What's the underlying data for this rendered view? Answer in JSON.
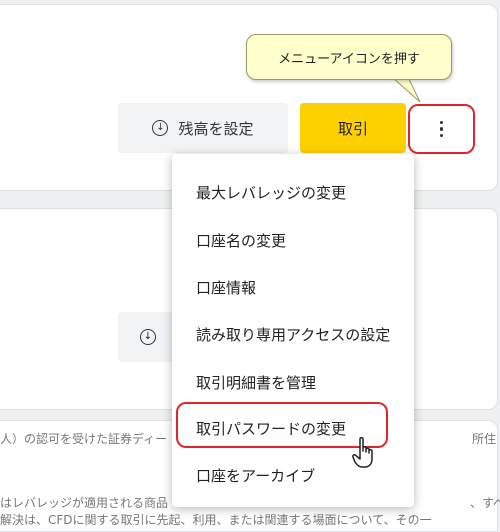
{
  "tooltip": {
    "text": "メニューアイコンを押す"
  },
  "actions": {
    "set_balance_label": "残高を設定",
    "trade_label": "取引"
  },
  "menu": {
    "items": [
      {
        "label": "最大レバレッジの変更"
      },
      {
        "label": "口座名の変更"
      },
      {
        "label": "口座情報"
      },
      {
        "label": "読み取り専用アクセスの設定"
      },
      {
        "label": "取引明細書を管理"
      },
      {
        "label": "取引パスワードの変更"
      },
      {
        "label": "口座をアーカイブ"
      }
    ]
  },
  "background": {
    "line1_left": "人）の認可を受けた証券ディー",
    "line1_right": "所住",
    "line2_left": "はレバレッジが適用される商品",
    "line2_right": "、すべ",
    "line3_left": "解決は、CFDに関する取引に先起、利用、または関連する場面について、その一"
  },
  "colors": {
    "accent": "#fdd000",
    "highlight": "#e0262a",
    "tooltip_bg": "#ffffcc"
  }
}
